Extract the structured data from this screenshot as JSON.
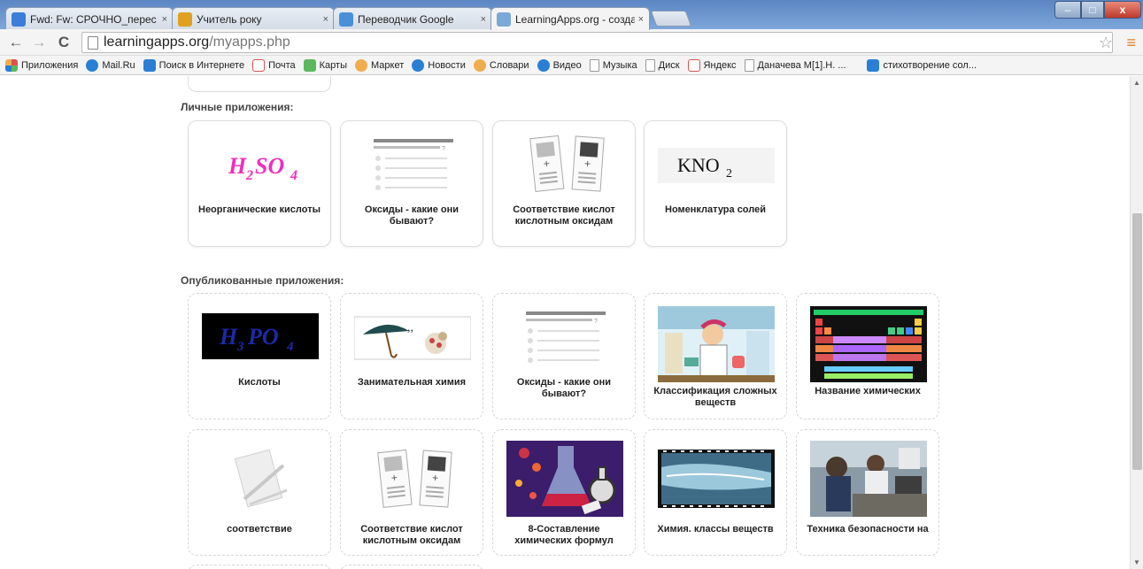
{
  "browser": {
    "tabs": [
      {
        "label": "Fwd: Fw: СРОЧНО_перес",
        "close": "×",
        "color": "#3b7dd8"
      },
      {
        "label": "Учитель року",
        "close": "×",
        "color": "#e0a020"
      },
      {
        "label": "Переводчик Google",
        "close": "×",
        "color": "#4a90d9"
      },
      {
        "label": "LearningApps.org - созда",
        "close": "×",
        "color": "#7aa8d8"
      }
    ],
    "window_controls": {
      "minimize": "–",
      "maximize": "□",
      "close": "x"
    },
    "url_host": "learningapps.org",
    "url_path": "/myapps.php",
    "star_icon": "☆",
    "menu_icon": "≡"
  },
  "bookmarks": [
    {
      "label": "Приложения",
      "color": "#d9534f"
    },
    {
      "label": "Mail.Ru",
      "color": "#2a7fd4"
    },
    {
      "label": "Поиск в Интернете",
      "color": "#2a7fd4"
    },
    {
      "label": "Почта",
      "color": "#d9534f"
    },
    {
      "label": "Карты",
      "color": "#5cb85c"
    },
    {
      "label": "Маркет",
      "color": "#f0ad4e"
    },
    {
      "label": "Новости",
      "color": "#2a7fd4"
    },
    {
      "label": "Словари",
      "color": "#f0ad4e"
    },
    {
      "label": "Видео",
      "color": "#2a7fd4"
    },
    {
      "label": "Музыка",
      "color": "#ffffff"
    },
    {
      "label": "Диск",
      "color": "#ffffff"
    },
    {
      "label": "Яндекс",
      "color": "#d9534f"
    },
    {
      "label": "Даначева М[1].Н. ...",
      "color": "#ffffff"
    },
    {
      "label": "стихотворение сол...",
      "color": "#2a7fd4"
    }
  ],
  "sections": {
    "personal_title": "Личные приложения:",
    "published_title": "Опубликованные приложения:"
  },
  "personal_apps": [
    {
      "title": "Неорганические кислоты",
      "thumb": "formula-h2so4",
      "formula": "H2SO4"
    },
    {
      "title": "Оксиды - какие они бывают?",
      "thumb": "quiz-icon"
    },
    {
      "title": "Соответствие кислот кислотным оксидам",
      "thumb": "matching-icon"
    },
    {
      "title": "Номенклатура солей",
      "thumb": "formula-kno2",
      "formula": "KNO2"
    }
  ],
  "published_apps_row1": [
    {
      "title": "Кислоты",
      "thumb": "formula-h3po4",
      "formula": "H3PO4"
    },
    {
      "title": "Занимательная химия",
      "thumb": "umbrella-image"
    },
    {
      "title": "Оксиды - какие они бывают?",
      "thumb": "quiz-icon"
    },
    {
      "title": "Классификация сложных веществ",
      "thumb": "scientist-image"
    },
    {
      "title": "Название химических",
      "thumb": "periodic-table-image"
    }
  ],
  "published_apps_row2": [
    {
      "title": "соответствие",
      "thumb": "tools-icon"
    },
    {
      "title": "Соответствие кислот кислотным оксидам",
      "thumb": "matching-icon"
    },
    {
      "title": "8-Составление химических формул",
      "thumb": "flask-image"
    },
    {
      "title": "Химия. классы веществ",
      "thumb": "filmstrip-image"
    },
    {
      "title": "Техника безопасности на",
      "thumb": "lab-photo-image"
    }
  ]
}
